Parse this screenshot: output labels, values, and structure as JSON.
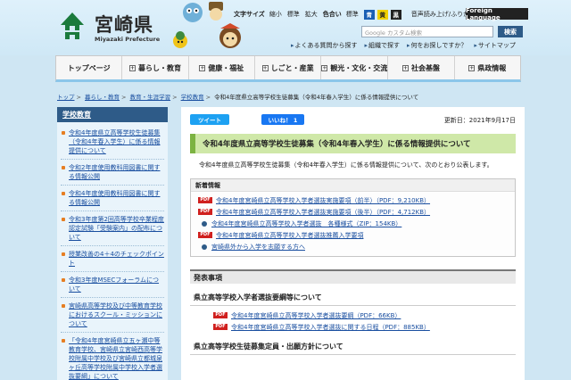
{
  "header": {
    "site_name": "宮崎県",
    "site_sub": "Miyazaki Prefecture",
    "text_size_label": "文字サイズ",
    "text_size_options": [
      "縮小",
      "標準",
      "拡大"
    ],
    "color_label": "色合い",
    "color_options": [
      "標準",
      "青",
      "黄",
      "黒"
    ],
    "read_aloud": "音声読み上げ/ふりがな",
    "foreign": "Foreign Language",
    "search_placeholder": "Google カスタム検索",
    "search_button": "検索",
    "sub_links": [
      "よくある質問から探す",
      "組織で探す",
      "何をお探しですか？",
      "サイトマップ"
    ],
    "colors": {
      "blue": "#1a5fb4",
      "yellow": "#f0d000",
      "black": "#222222"
    }
  },
  "gnav": [
    {
      "label": "トップページ",
      "plus": false
    },
    {
      "label": "暮らし・教育",
      "plus": true
    },
    {
      "label": "健康・福祉",
      "plus": true
    },
    {
      "label": "しごと・産業",
      "plus": true
    },
    {
      "label": "観光・文化・交流",
      "plus": true
    },
    {
      "label": "社会基盤",
      "plus": true
    },
    {
      "label": "県政情報",
      "plus": true
    }
  ],
  "breadcrumb": {
    "links": [
      "トップ",
      "暮らし・教育",
      "教育・生涯学習",
      "学校教育"
    ],
    "current": "令和4年度県立高等学校生徒募集（令和4年春入学生）に係る情報提供について"
  },
  "sidebar": {
    "title": "学校教育",
    "items": [
      "令和4年度県立高等学校生徒募集（令和4年春入学生）に係る情報提供について",
      "令和2年度使用教科用図書に関する情報公開",
      "令和4年度使用教科用図書に関する情報公開",
      "令和3年度第2回高等学校卒業程度認定試験「受験案内」の配布について",
      "授業改善の4＋4のチェックポイント",
      "令和3年度MSECフォーラムについて",
      "宮崎県高等学校及び中等教育学校におけるスクール・ミッションについて",
      "「令和4年度宮崎県立五ヶ瀬中等教育学校、宮崎県立宮崎西高等学校附属中学校及び宮崎県立都城泉ヶ丘高等学校附属中学校入学者選抜要綱」について"
    ]
  },
  "main": {
    "tweet": "ツイート",
    "like": "いいね！ 1",
    "updated": "更新日：2021年9月17日",
    "title": "令和4年度県立高等学校生徒募集（令和4年春入学生）に係る情報提供について",
    "intro": "令和4年度県立高等学校生徒募集（令和4年春入学生）に係る情報提供について、次のとおり公表します。",
    "news_heading": "新着情報",
    "news": [
      {
        "type": "pdf",
        "text": "令和4年度宮崎県立高等学校入学者選抜実施要項（前半）（PDF：9,210KB）"
      },
      {
        "type": "pdf",
        "text": "令和4年度宮崎県立高等学校入学者選抜実施要項（後半）（PDF：4,712KB）"
      },
      {
        "type": "link",
        "text": "令和4年度宮崎県立高等学校入学者選抜　各種様式（ZIP：154KB）"
      },
      {
        "type": "pdf",
        "text": "令和4年度宮崎県立高等学校入学者選抜推薦入学要項"
      },
      {
        "type": "link",
        "text": "宮崎県外から入学を志願する方へ"
      }
    ],
    "press_heading": "発表事項",
    "sub1_heading": "県立高等学校入学者選抜要綱等について",
    "sub1_items": [
      "令和4年度宮崎県立高等学校入学者選抜要綱（PDF：66KB）",
      "令和4年度宮崎県立高等学校入学者選抜に関する日程（PDF：885KB）"
    ],
    "sub2_heading": "県立高等学校生徒募集定員・出願方針について",
    "pdf_label": "PDF"
  }
}
